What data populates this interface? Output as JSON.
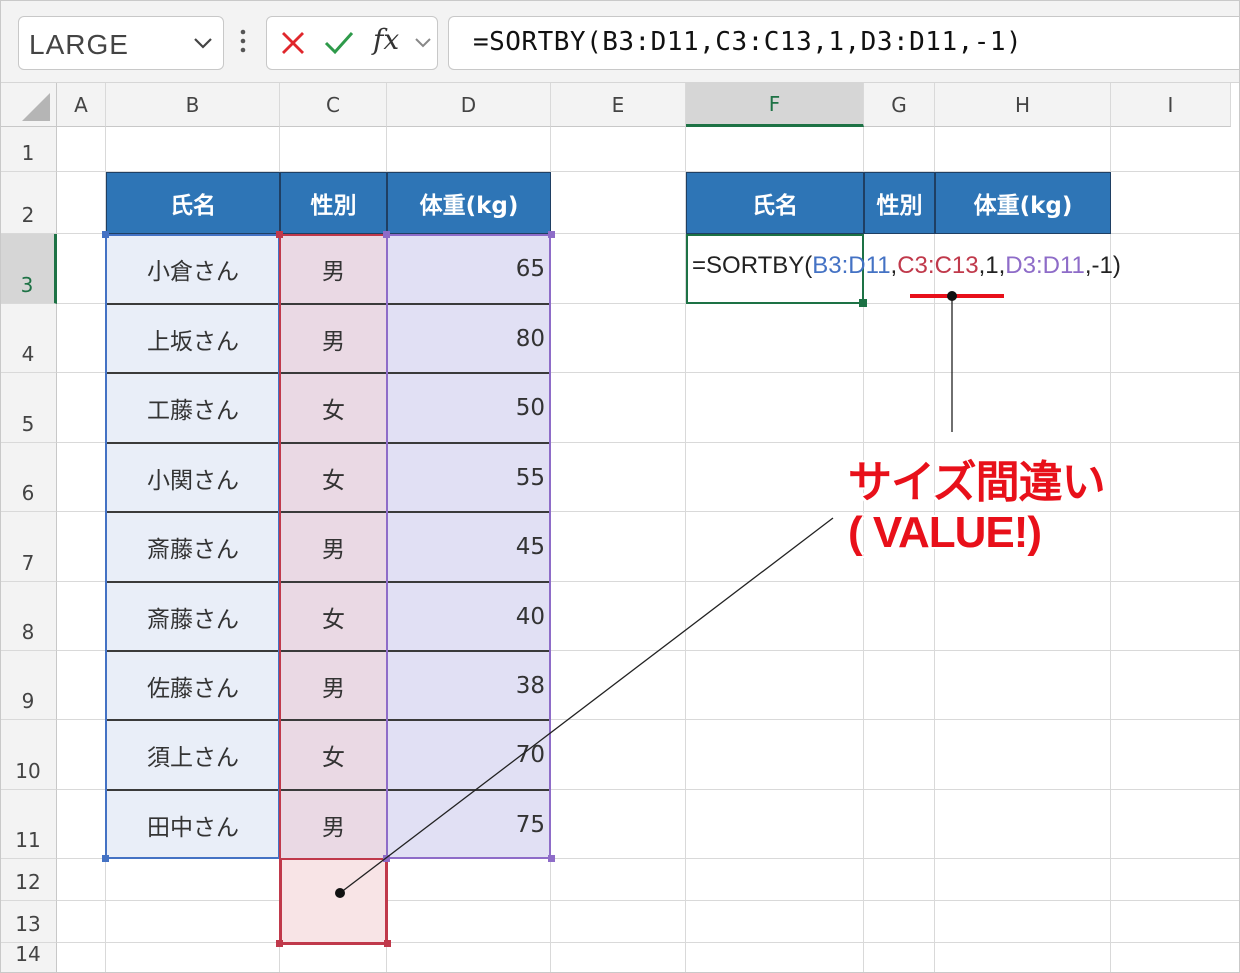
{
  "namebox": {
    "value": "LARGE"
  },
  "formula_bar": {
    "cancel_icon": "x-icon",
    "enter_icon": "check-icon",
    "fx_label": "fx",
    "formula": "=SORTBY(B3:D11,C3:C13,1,D3:D11,-1)"
  },
  "columns": [
    "A",
    "B",
    "C",
    "D",
    "E",
    "F",
    "G",
    "H",
    "I"
  ],
  "selected_column": "F",
  "rows": [
    "1",
    "2",
    "3",
    "4",
    "5",
    "6",
    "7",
    "8",
    "9",
    "10",
    "11",
    "12",
    "13",
    "14"
  ],
  "selected_row": "3",
  "source_table": {
    "headers": [
      "氏名",
      "性別",
      "体重(kg)"
    ],
    "rows": [
      {
        "name": "小倉さん",
        "gender": "男",
        "weight": "65"
      },
      {
        "name": "上坂さん",
        "gender": "男",
        "weight": "80"
      },
      {
        "name": "工藤さん",
        "gender": "女",
        "weight": "50"
      },
      {
        "name": "小関さん",
        "gender": "女",
        "weight": "55"
      },
      {
        "name": "斎藤さん",
        "gender": "男",
        "weight": "45"
      },
      {
        "name": "斎藤さん",
        "gender": "女",
        "weight": "40"
      },
      {
        "name": "佐藤さん",
        "gender": "男",
        "weight": "38"
      },
      {
        "name": "須上さん",
        "gender": "女",
        "weight": "70"
      },
      {
        "name": "田中さん",
        "gender": "男",
        "weight": "75"
      }
    ]
  },
  "result_table": {
    "headers": [
      "氏名",
      "性別",
      "体重(kg)"
    ]
  },
  "cell_formula": {
    "parts": [
      {
        "text": "=SORTBY(",
        "color": "#222222"
      },
      {
        "text": "B3:D11",
        "color": "#4472c4"
      },
      {
        "text": ",",
        "color": "#222222"
      },
      {
        "text": "C3:C13",
        "color": "#c0394b"
      },
      {
        "text": ",1,",
        "color": "#222222"
      },
      {
        "text": "D3:D11",
        "color": "#8e6cc8"
      },
      {
        "text": ",-1)",
        "color": "#222222"
      }
    ]
  },
  "annotation": {
    "line1": "サイズ間違い",
    "line2": "( VALUE!)"
  },
  "colors": {
    "header_fill": "#2e75b6",
    "name_range": "#4472c4",
    "gender_range": "#c0394b",
    "weight_range": "#8e6cc8",
    "callout": "#e8101a",
    "selection": "#1d7245"
  }
}
